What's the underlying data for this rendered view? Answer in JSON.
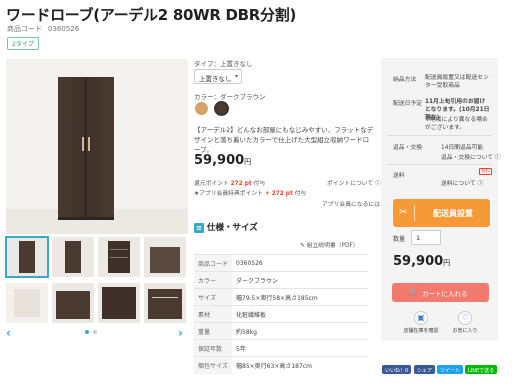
{
  "product": {
    "title": "ワードローブ(アーデル2 80WR DBR分割)",
    "code_label": "商品コード",
    "code_value": "0360526",
    "tag": "2タイプ"
  },
  "options": {
    "type_label": "タイプ：上置きなし",
    "type_selected": "上置きなし",
    "color_label": "カラー：ダークブラウン",
    "swatches": [
      "#d4a36a",
      "#4a3a30"
    ]
  },
  "description": "【アーデル2】どんなお部屋にもなじみやすい、フラットなデザインと落ち着いたカラーで仕上げた大型組立収納ワードローブ。",
  "pricing": {
    "price": "59,900",
    "currency": "円",
    "points_label": "還元ポイント",
    "points_value": "272 pt",
    "points_suffix": "付与",
    "points_about": "ポイントについて",
    "app_points_label": "★アプリ会員特典ポイント",
    "app_points_value": "+ 272 pt",
    "app_points_suffix": "付与",
    "app_about": "アプリ会員になるには"
  },
  "spec": {
    "title": "仕様・サイズ",
    "manual": "組立説明書（PDF）",
    "rows": [
      {
        "k": "商品コード",
        "v": "0360526"
      },
      {
        "k": "カラー",
        "v": "ダークブラウン"
      },
      {
        "k": "サイズ",
        "v": "幅79.5×奥行58×高さ185cm"
      },
      {
        "k": "素材",
        "v": "化粧繊維板"
      },
      {
        "k": "重量",
        "v": "約58kg"
      },
      {
        "k": "保証年数",
        "v": "5年"
      },
      {
        "k": "梱包サイズ",
        "v": "幅85×奥行63×高さ187cm"
      }
    ]
  },
  "panel": {
    "delivery_method_label": "納品方法",
    "delivery_method_value": "配送員設置又は配送センター受取商品",
    "delivery_date_label": "配送日予定",
    "delivery_date_value": "11月上旬引用のお届けとなります。(10月21日現在)",
    "delivery_note": "※地域により異なる場合がございます。",
    "return_label": "返品・交換",
    "return_value": "14日間返品可能",
    "return_link": "返品・交換について",
    "shipping_label": "送料",
    "shipping_badge": "有料",
    "shipping_link": "送料について",
    "deliver_button": "配送員設置",
    "qty_label": "数量",
    "qty_value": "1",
    "price": "59,900",
    "currency": "円",
    "cart_button": "カートに入れる",
    "store_stock": "店舗在庫を確認",
    "favorite": "お気に入り"
  },
  "share": {
    "like": "いいね！0",
    "share": "シェア",
    "tweet": "ツイート",
    "line": "LINEで送る"
  }
}
